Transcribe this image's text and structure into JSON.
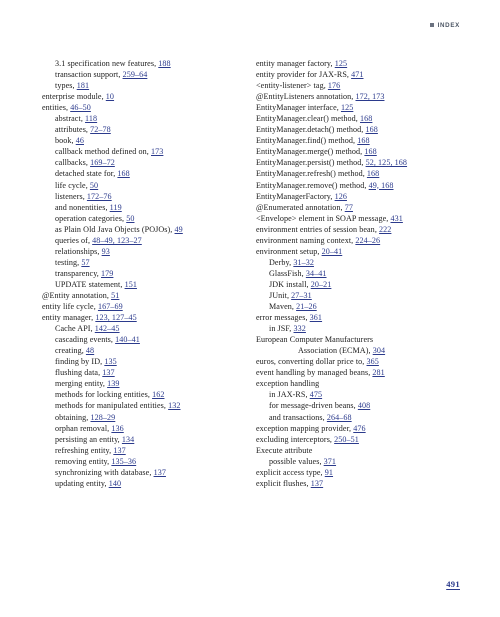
{
  "header": {
    "bullet_icon": "square-bullet-icon",
    "label": "INDEX"
  },
  "footer": {
    "page_number": "491"
  },
  "columns": [
    {
      "name": "left-column",
      "entries": [
        {
          "level": 1,
          "text": "3.1 specification new features, ",
          "pages": "188"
        },
        {
          "level": 1,
          "text": "transaction support, ",
          "pages": "259–64"
        },
        {
          "level": 1,
          "text": "types, ",
          "pages": "181"
        },
        {
          "level": 0,
          "text": "enterprise module, ",
          "pages": "10"
        },
        {
          "level": 0,
          "text": "entities, ",
          "pages": "46–50"
        },
        {
          "level": 1,
          "text": "abstract, ",
          "pages": "118"
        },
        {
          "level": 1,
          "text": "attributes, ",
          "pages": "72–78"
        },
        {
          "level": 1,
          "text": "book, ",
          "pages": "46"
        },
        {
          "level": 1,
          "text": "callback method defined on, ",
          "pages": "173"
        },
        {
          "level": 1,
          "text": "callbacks, ",
          "pages": "169–72"
        },
        {
          "level": 1,
          "text": "detached state for, ",
          "pages": "168"
        },
        {
          "level": 1,
          "text": "life cycle, ",
          "pages": "50"
        },
        {
          "level": 1,
          "text": "listeners, ",
          "pages": "172–76"
        },
        {
          "level": 1,
          "text": "and nonentities, ",
          "pages": "119"
        },
        {
          "level": 1,
          "text": "operation categories, ",
          "pages": "50"
        },
        {
          "level": 1,
          "text": "as Plain Old Java Objects (POJOs), ",
          "pages": "49"
        },
        {
          "level": 1,
          "text": "queries of, ",
          "pages": "48–49, 123–27"
        },
        {
          "level": 1,
          "text": "relationships, ",
          "pages": "93"
        },
        {
          "level": 1,
          "text": "testing, ",
          "pages": "57"
        },
        {
          "level": 1,
          "text": "transparency, ",
          "pages": "179"
        },
        {
          "level": 1,
          "text": "UPDATE statement, ",
          "pages": "151"
        },
        {
          "level": 0,
          "text": "@Entity annotation, ",
          "pages": "51"
        },
        {
          "level": 0,
          "text": "entity life cycle, ",
          "pages": "167–69"
        },
        {
          "level": 0,
          "text": "entity manager, ",
          "pages": "123, 127–45"
        },
        {
          "level": 1,
          "text": "Cache API, ",
          "pages": "142–45"
        },
        {
          "level": 1,
          "text": "cascading events, ",
          "pages": "140–41"
        },
        {
          "level": 1,
          "text": "creating, ",
          "pages": "48"
        },
        {
          "level": 1,
          "text": "finding by ID, ",
          "pages": "135"
        },
        {
          "level": 1,
          "text": "flushing data, ",
          "pages": "137"
        },
        {
          "level": 1,
          "text": "merging entity, ",
          "pages": "139"
        },
        {
          "level": 1,
          "text": "methods for locking entities, ",
          "pages": "162"
        },
        {
          "level": 1,
          "text": "methods for manipulated entities, ",
          "pages": "132"
        },
        {
          "level": 1,
          "text": "obtaining, ",
          "pages": "128–29"
        },
        {
          "level": 1,
          "text": "orphan removal, ",
          "pages": "136"
        },
        {
          "level": 1,
          "text": "persisting an entity, ",
          "pages": "134"
        },
        {
          "level": 1,
          "text": "refreshing entity, ",
          "pages": "137"
        },
        {
          "level": 1,
          "text": "removing entity, ",
          "pages": "135–36"
        },
        {
          "level": 1,
          "text": "synchronizing with database, ",
          "pages": "137"
        },
        {
          "level": 1,
          "text": "updating entity, ",
          "pages": "140"
        }
      ]
    },
    {
      "name": "right-column",
      "entries": [
        {
          "level": 0,
          "text": "entity manager factory, ",
          "pages": "125"
        },
        {
          "level": 0,
          "text": "entity provider for JAX-RS, ",
          "pages": "471"
        },
        {
          "level": 0,
          "text": "<entity-listener> tag, ",
          "pages": "176"
        },
        {
          "level": 0,
          "text": "@EntityListeners annotation, ",
          "pages": "172, 173"
        },
        {
          "level": 0,
          "text": "EntityManager interface, ",
          "pages": "125"
        },
        {
          "level": 0,
          "text": "EntityManager.clear() method, ",
          "pages": "168"
        },
        {
          "level": 0,
          "text": "EntityManager.detach() method, ",
          "pages": "168"
        },
        {
          "level": 0,
          "text": "EntityManager.find() method, ",
          "pages": "168"
        },
        {
          "level": 0,
          "text": "EntityManager.merge() method, ",
          "pages": "168"
        },
        {
          "level": 0,
          "text": "EntityManager.persist() method, ",
          "pages": "52, 125, 168"
        },
        {
          "level": 0,
          "text": "EntityManager.refresh() method, ",
          "pages": "168"
        },
        {
          "level": 0,
          "text": "EntityManager.remove() method, ",
          "pages": "49, 168"
        },
        {
          "level": 0,
          "text": "EntityManagerFactory, ",
          "pages": "126"
        },
        {
          "level": 0,
          "text": "@Enumerated annotation, ",
          "pages": "77"
        },
        {
          "level": 0,
          "text": "<Envelope> element in SOAP message, ",
          "pages": "431"
        },
        {
          "level": 0,
          "text": "environment entries of session bean, ",
          "pages": "222"
        },
        {
          "level": 0,
          "text": "environment naming context, ",
          "pages": "224–26"
        },
        {
          "level": 0,
          "text": "environment setup, ",
          "pages": "20–41"
        },
        {
          "level": 1,
          "text": "Derby, ",
          "pages": "31–32"
        },
        {
          "level": 1,
          "text": "GlassFish, ",
          "pages": "34–41"
        },
        {
          "level": 1,
          "text": "JDK install, ",
          "pages": "20–21"
        },
        {
          "level": 1,
          "text": "JUnit, ",
          "pages": "27–31"
        },
        {
          "level": 1,
          "text": "Maven, ",
          "pages": "21–26"
        },
        {
          "level": 0,
          "text": "error messages, ",
          "pages": "361"
        },
        {
          "level": 1,
          "text": "in JSF, ",
          "pages": "332"
        },
        {
          "level": 0,
          "text": "European Computer Manufacturers",
          "pages": ""
        },
        {
          "level": 3,
          "text": "Association (ECMA), ",
          "pages": "304"
        },
        {
          "level": 0,
          "text": "euros, converting dollar price to, ",
          "pages": "365"
        },
        {
          "level": 0,
          "text": "event handling by managed beans, ",
          "pages": "281"
        },
        {
          "level": 0,
          "text": "exception handling",
          "pages": ""
        },
        {
          "level": 1,
          "text": "in JAX-RS, ",
          "pages": "475"
        },
        {
          "level": 1,
          "text": "for message-driven beans, ",
          "pages": "408"
        },
        {
          "level": 1,
          "text": "and transactions, ",
          "pages": "264–68"
        },
        {
          "level": 0,
          "text": "exception mapping provider, ",
          "pages": "476"
        },
        {
          "level": 0,
          "text": "excluding interceptors, ",
          "pages": "250–51"
        },
        {
          "level": 0,
          "text": "Execute attribute",
          "pages": ""
        },
        {
          "level": 1,
          "text": "possible values, ",
          "pages": "371"
        },
        {
          "level": 0,
          "text": "explicit access type, ",
          "pages": "91"
        },
        {
          "level": 0,
          "text": "explicit flushes, ",
          "pages": "137"
        }
      ]
    }
  ]
}
